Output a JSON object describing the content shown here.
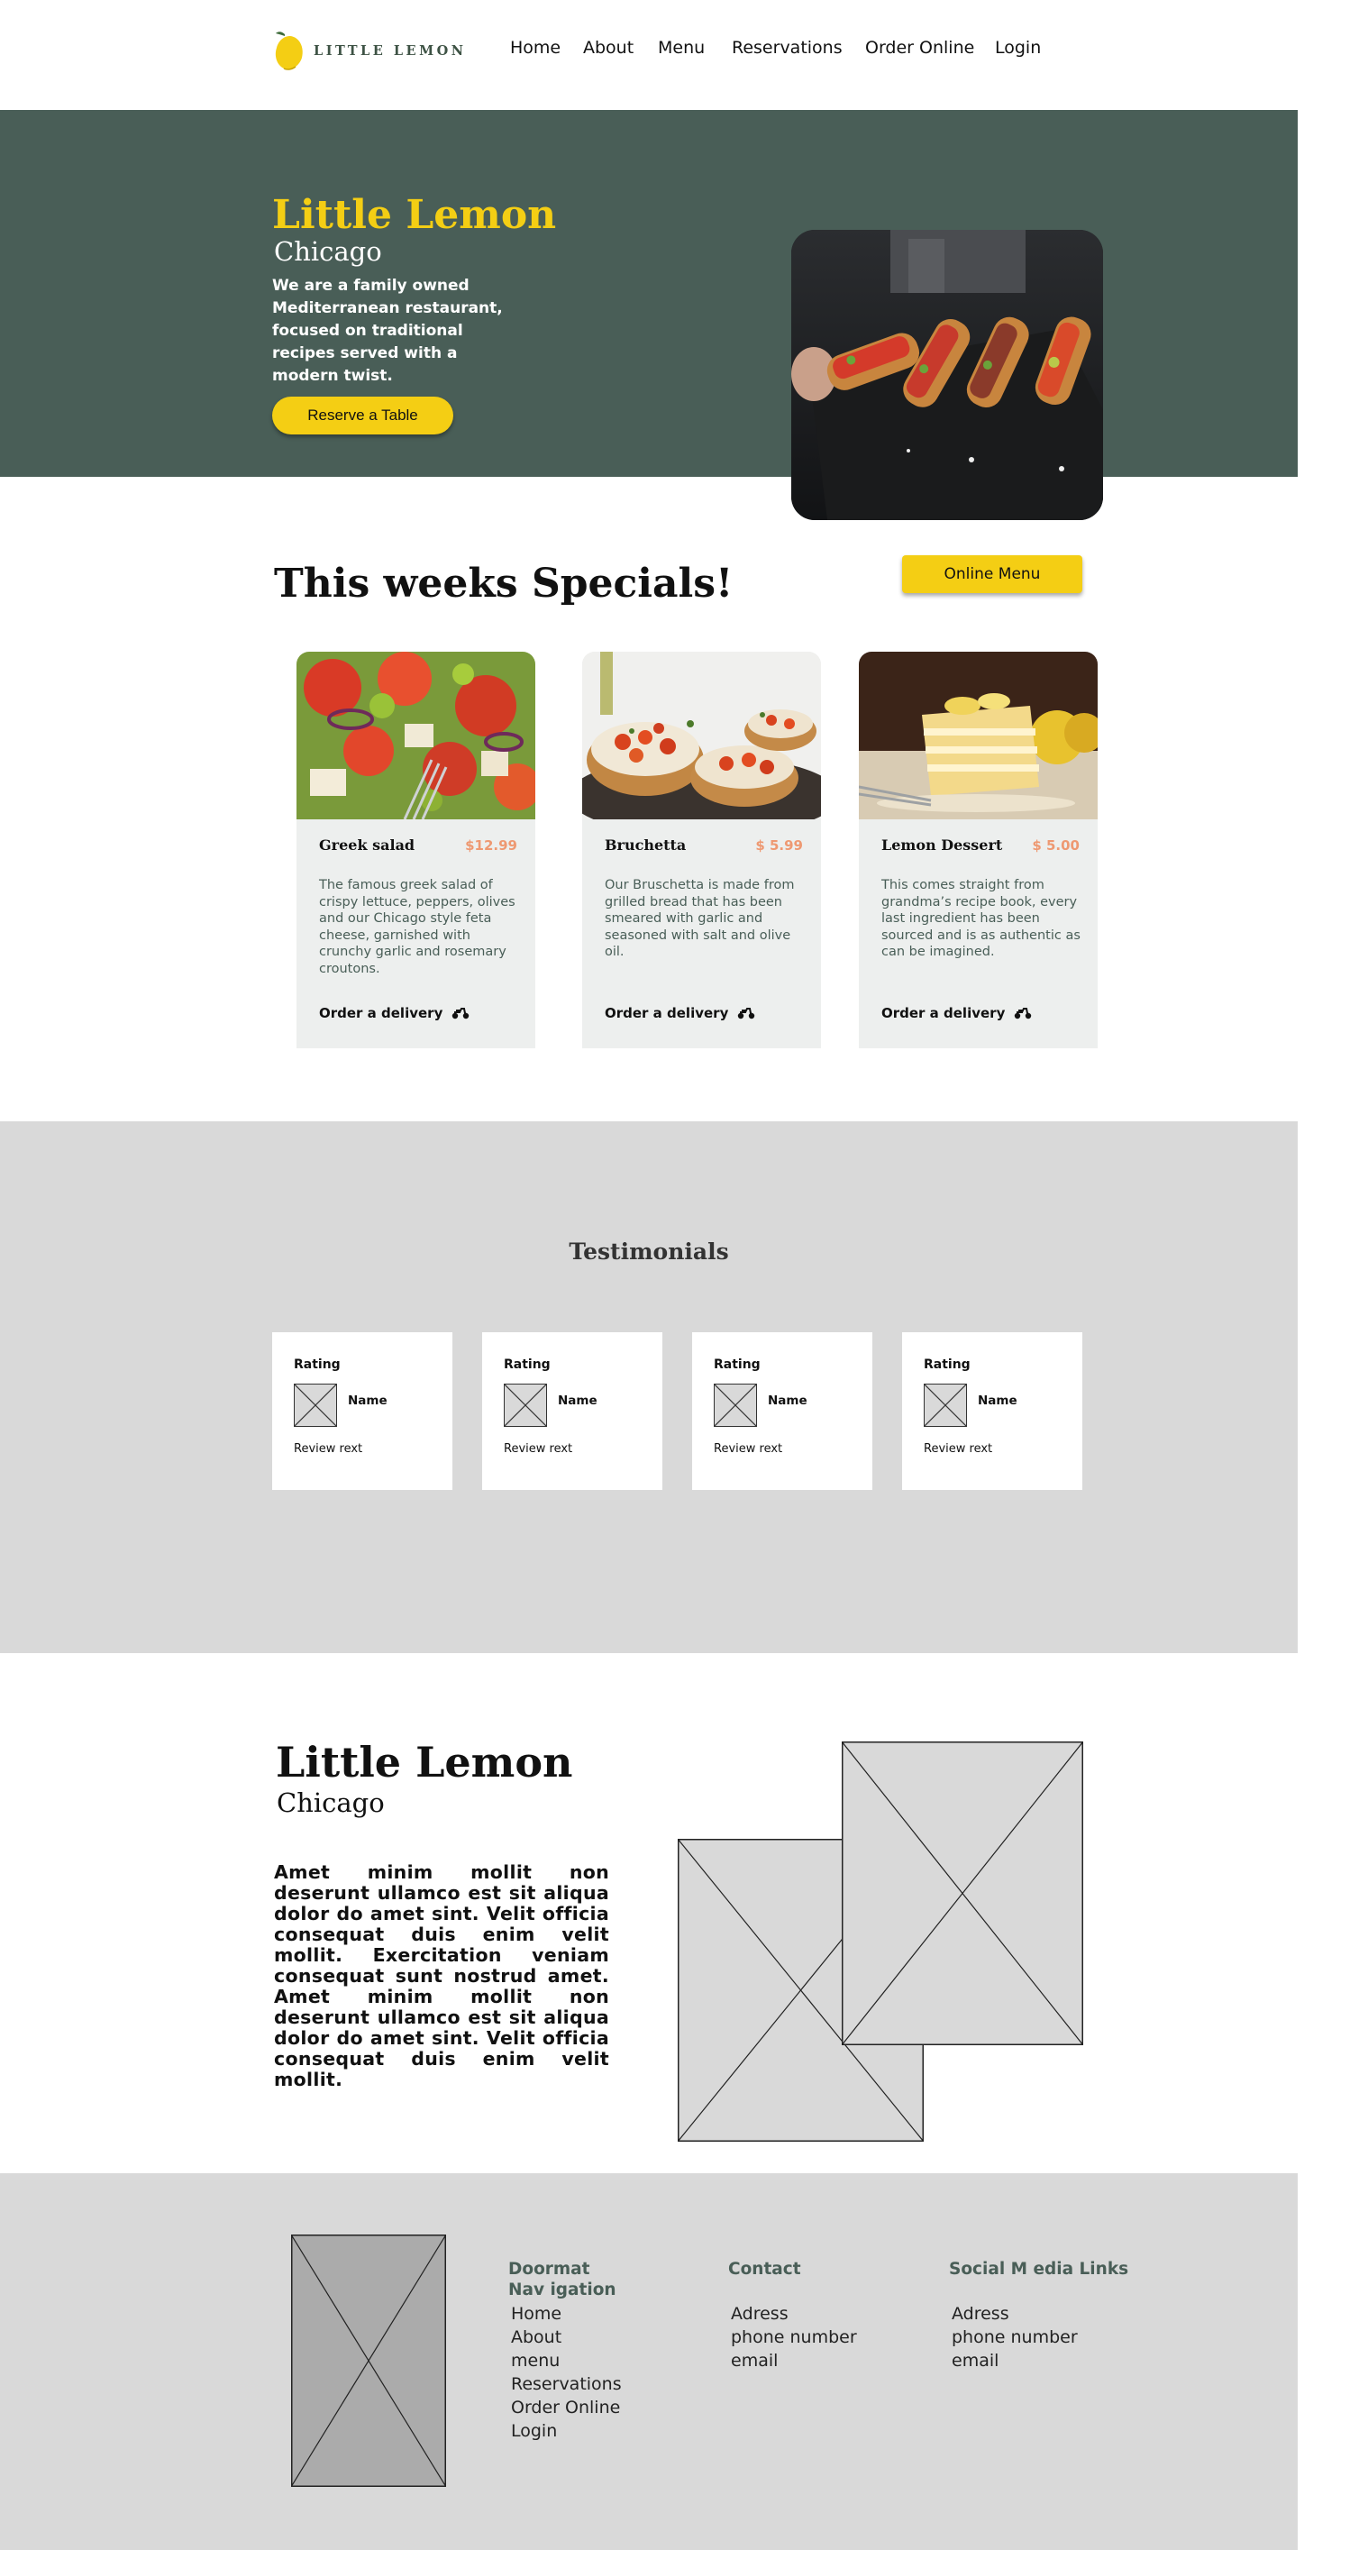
{
  "brand": {
    "logo_text": "LITTLE LEMON"
  },
  "nav": {
    "items": [
      {
        "label": "Home"
      },
      {
        "label": "About"
      },
      {
        "label": "Menu"
      },
      {
        "label": "Reservations"
      },
      {
        "label": "Order Online"
      },
      {
        "label": "Login"
      }
    ]
  },
  "hero": {
    "title": "Little Lemon",
    "subtitle": "Chicago",
    "description": "We are a family owned Mediterranean restaurant, focused on traditional recipes served with a modern twist.",
    "cta_label": "Reserve a Table"
  },
  "specials": {
    "title": "This weeks Specials!",
    "menu_button": "Online Menu",
    "cards": [
      {
        "name": "Greek salad",
        "price": "$12.99",
        "description": "The famous greek salad of crispy lettuce, peppers, olives and our Chicago style feta cheese, garnished with crunchy garlic and rosemary croutons.",
        "order_label": "Order a delivery"
      },
      {
        "name": "Bruchetta",
        "price": "$ 5.99",
        "description": "Our Bruschetta is made from grilled bread that has been smeared with garlic and seasoned with salt and olive oil.",
        "order_label": "Order a delivery"
      },
      {
        "name": "Lemon Dessert",
        "price": "$ 5.00",
        "description": "This comes straight from grandma’s recipe book, every last ingredient has been sourced and is as authentic as can be imagined.",
        "order_label": "Order a delivery"
      }
    ]
  },
  "testimonials": {
    "title": "Testimonials",
    "cards": [
      {
        "rating": "Rating",
        "name": "Name",
        "review": "Review rext"
      },
      {
        "rating": "Rating",
        "name": "Name",
        "review": "Review rext"
      },
      {
        "rating": "Rating",
        "name": "Name",
        "review": "Review rext"
      },
      {
        "rating": "Rating",
        "name": "Name",
        "review": "Review rext"
      }
    ]
  },
  "about": {
    "title": "Little Lemon",
    "subtitle": "Chicago",
    "text": "Amet minim mollit non deserunt ullamco est sit aliqua dolor do amet sint. Velit officia consequat duis enim velit mollit. Exercitation veniam consequat sunt nostrud amet. Amet minim mollit non deserunt ullamco est sit aliqua dolor do amet sint. Velit officia consequat duis enim velit mollit."
  },
  "footer": {
    "doormat": {
      "heading_line1": "Doormat",
      "heading_line2": "Nav igation",
      "links": [
        "Home",
        "About",
        "menu",
        "Reservations",
        "Order Online",
        "Login"
      ]
    },
    "contact": {
      "heading": "Contact",
      "links": [
        "Adress",
        "phone number",
        "email"
      ]
    },
    "social": {
      "heading": "Social M edia Links",
      "links": [
        "Adress",
        "phone number",
        "email"
      ]
    }
  },
  "colors": {
    "primary_green": "#495e57",
    "primary_yellow": "#f4ce14",
    "price_salmon": "#ee9972",
    "card_bg": "#edefee",
    "section_grey": "#d9d9d9"
  }
}
